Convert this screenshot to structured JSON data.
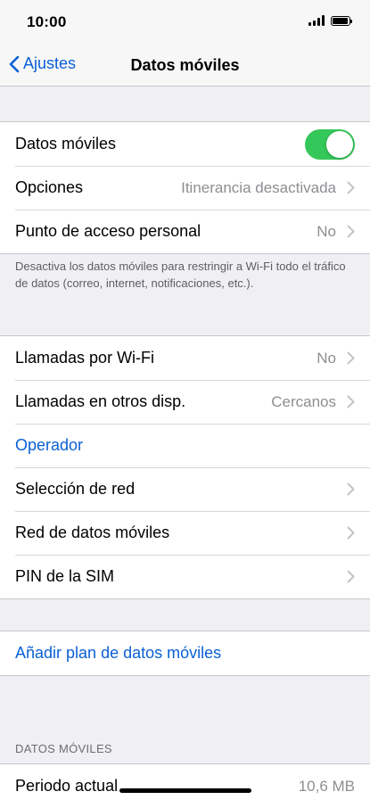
{
  "status_bar": {
    "time": "10:00"
  },
  "nav": {
    "back_label": "Ajustes",
    "title": "Datos móviles"
  },
  "group1": {
    "datos_moviles": {
      "label": "Datos móviles",
      "toggle_on": true
    },
    "opciones": {
      "label": "Opciones",
      "value": "Itinerancia desactivada"
    },
    "punto_acceso": {
      "label": "Punto de acceso personal",
      "value": "No"
    }
  },
  "footnote": "Desactiva los datos móviles para restringir a Wi-Fi todo el tráfico de datos (correo, internet, notificaciones, etc.).",
  "group2": {
    "llamadas_wifi": {
      "label": "Llamadas por Wi-Fi",
      "value": "No"
    },
    "llamadas_otros": {
      "label": "Llamadas en otros disp.",
      "value": "Cercanos"
    },
    "operador": {
      "label": "Operador"
    },
    "seleccion_red": {
      "label": "Selección de red"
    },
    "red_datos": {
      "label": "Red de datos móviles"
    },
    "pin_sim": {
      "label": "PIN de la SIM"
    }
  },
  "group3": {
    "anadir_plan": {
      "label": "Añadir plan de datos móviles"
    }
  },
  "section_datos": {
    "header": "DATOS MÓVILES",
    "periodo": {
      "label": "Periodo actual",
      "value": "10,6 MB"
    }
  },
  "colors": {
    "accent": "#0a60d6",
    "toggle_on": "#34c759",
    "background": "#efeff4"
  }
}
